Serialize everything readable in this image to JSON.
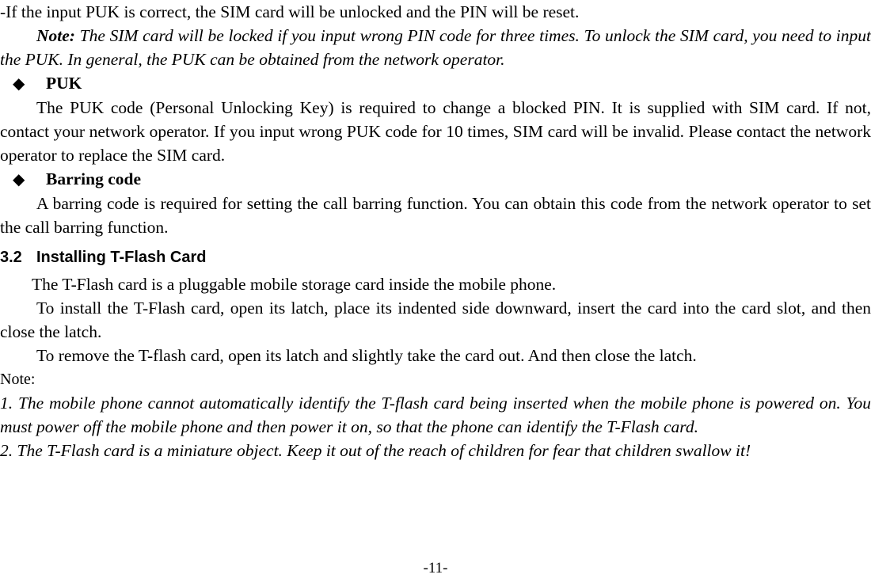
{
  "document": {
    "page_number_label": "-11-"
  },
  "body": {
    "line_puk_correct": "-If the input PUK is correct, the SIM card will be unlocked and the PIN will be reset.",
    "note_sim_lock": {
      "label": "Note:",
      "text": " The SIM card will be locked if you input wrong PIN code for three times. To unlock the SIM card, you need to input the PUK. In general, the PUK can be obtained from the network operator."
    },
    "bullet_puk": {
      "glyph": "◆",
      "label": "PUK",
      "paragraph": "The PUK code (Personal Unlocking Key) is required to change a blocked PIN. It is supplied with SIM card. If not, contact your network operator. If you input wrong PUK code for 10 times, SIM card will be invalid. Please contact the network operator to replace the SIM card."
    },
    "bullet_barring": {
      "glyph": "◆",
      "label": "Barring code",
      "paragraph": "A barring code is required for setting the call barring function. You can obtain this code from the network operator to set the call barring function."
    },
    "section_3_2": {
      "number": "3.2",
      "title": "Installing T-Flash Card",
      "paragraph_1": "The T-Flash card is a pluggable mobile storage card inside the mobile phone.",
      "paragraph_2": "To install the T-Flash card, open its latch, place its indented side downward, insert the card into the card slot, and then close the latch.",
      "paragraph_3": "To remove the T-flash card, open its latch and slightly take the card out. And then close the latch."
    },
    "notes": {
      "label": "Note:",
      "items": [
        "1. The mobile phone cannot automatically identify the T-flash card being inserted when the mobile phone is powered on. You must power off the mobile phone and then power it on, so that the phone can identify the T-Flash card.",
        "2. The T-Flash card is a miniature object. Keep it out of the reach of children for fear that children swallow it!"
      ]
    }
  }
}
